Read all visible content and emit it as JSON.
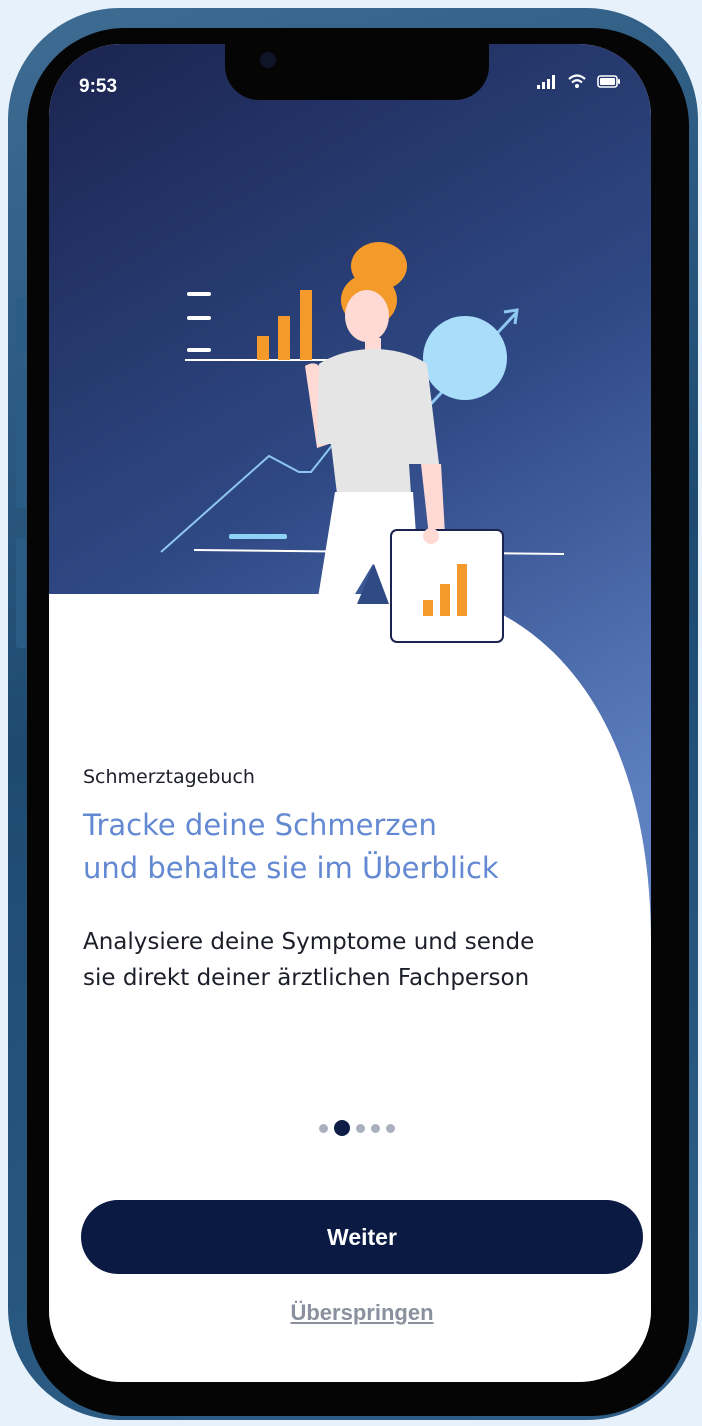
{
  "status_bar": {
    "time": "9:53",
    "icons": [
      "signal-icon",
      "wifi-icon",
      "battery-icon"
    ]
  },
  "onboarding": {
    "eyebrow": "Schmerztagebuch",
    "headline_line1": "Tracke deine Schmerzen",
    "headline_line2": "und behalte sie im Überblick",
    "body_line1": "Analysiere deine Symptome und sende",
    "body_line2": "sie direkt deiner ärztlichen Fachperson",
    "page_total": 5,
    "page_active": 2
  },
  "actions": {
    "continue_label": "Weiter",
    "skip_label": "Überspringen"
  },
  "colors": {
    "primary_dark": "#0b1a43",
    "headline_blue": "#6489d3",
    "accent_orange": "#f39a2b",
    "muted_gray": "#8a909d"
  }
}
